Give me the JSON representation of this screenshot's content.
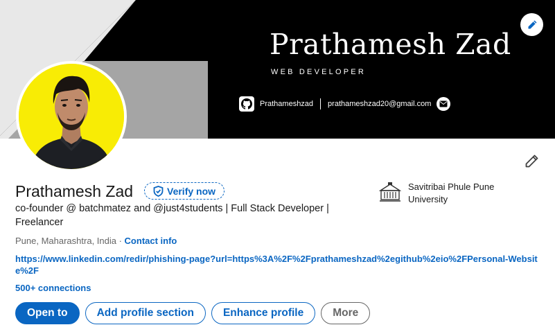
{
  "banner": {
    "name": "Prathamesh Zad",
    "role": "WEB DEVELOPER",
    "github_handle": "Prathameshzad",
    "email": "prathameshzad20@gmail.com"
  },
  "profile": {
    "name": "Prathamesh Zad",
    "verify_label": "Verify now",
    "headline": "co-founder @ batchmatez and @just4students | Full Stack Developer | Freelancer",
    "location": "Pune, Maharashtra, India",
    "location_separator": " · ",
    "contact_info_label": "Contact info",
    "website_url": "https://www.linkedin.com/redir/phishing-page?url=https%3A%2F%2Fprathameshzad%2egithub%2eio%2FPersonal-Website%2F",
    "connections": "500+ connections"
  },
  "education": {
    "name": "Savitribai Phule Pune University"
  },
  "actions": {
    "open_to": "Open to",
    "add_section": "Add profile section",
    "enhance": "Enhance profile",
    "more": "More"
  },
  "colors": {
    "accent": "#0a66c2",
    "avatar_bg": "#f8ec05",
    "banner_bg": "#000000"
  }
}
